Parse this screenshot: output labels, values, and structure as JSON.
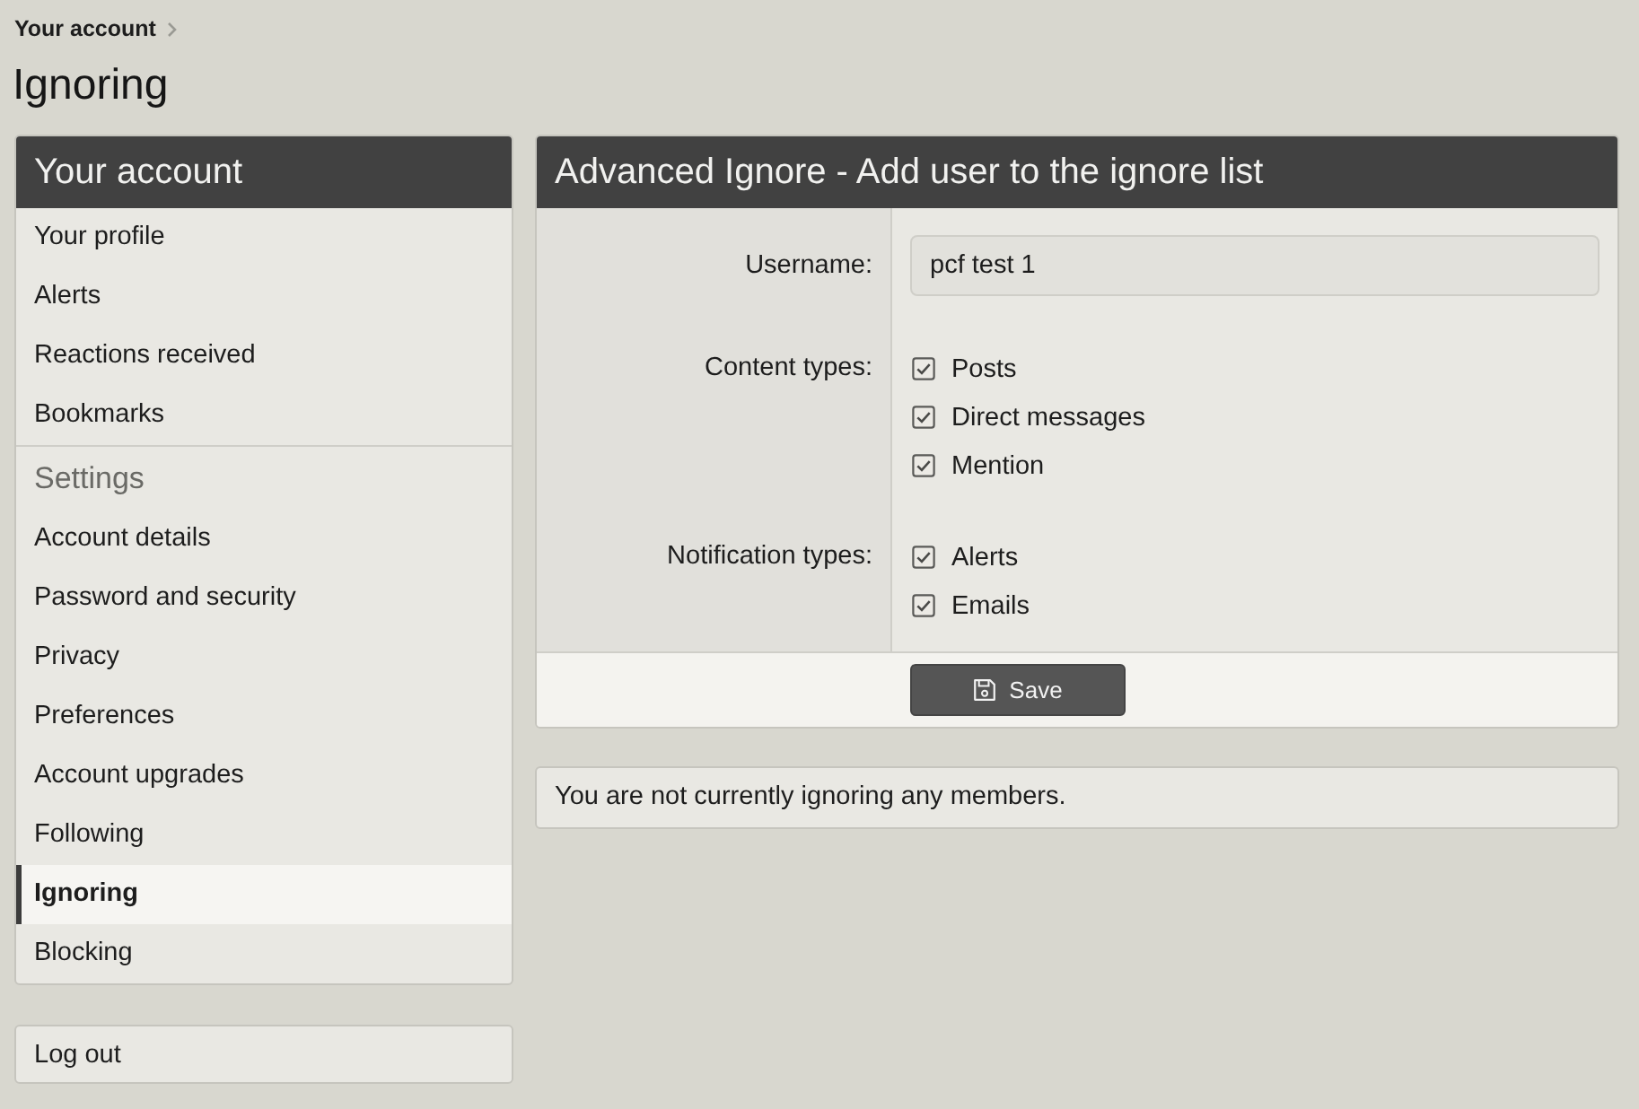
{
  "breadcrumb": [
    {
      "label": "Your account"
    }
  ],
  "page_title": "Ignoring",
  "sidebar": {
    "title": "Your account",
    "groups": [
      {
        "items": [
          {
            "label": "Your profile",
            "selected": false
          },
          {
            "label": "Alerts",
            "selected": false
          },
          {
            "label": "Reactions received",
            "selected": false
          },
          {
            "label": "Bookmarks",
            "selected": false
          }
        ]
      },
      {
        "heading": "Settings",
        "items": [
          {
            "label": "Account details",
            "selected": false
          },
          {
            "label": "Password and security",
            "selected": false
          },
          {
            "label": "Privacy",
            "selected": false
          },
          {
            "label": "Preferences",
            "selected": false
          },
          {
            "label": "Account upgrades",
            "selected": false
          },
          {
            "label": "Following",
            "selected": false
          },
          {
            "label": "Ignoring",
            "selected": true
          },
          {
            "label": "Blocking",
            "selected": false
          }
        ]
      }
    ]
  },
  "logout": {
    "label": "Log out"
  },
  "form": {
    "title": "Advanced Ignore - Add user to the ignore list",
    "fields": [
      {
        "kind": "text",
        "label": "Username:",
        "value": "pcf test 1"
      },
      {
        "kind": "checkboxes",
        "label": "Content types:",
        "options": [
          {
            "label": "Posts",
            "checked": true
          },
          {
            "label": "Direct messages",
            "checked": true
          },
          {
            "label": "Mention",
            "checked": true
          }
        ]
      },
      {
        "kind": "checkboxes",
        "label": "Notification types:",
        "options": [
          {
            "label": "Alerts",
            "checked": true
          },
          {
            "label": "Emails",
            "checked": true
          }
        ]
      }
    ],
    "submit": {
      "label": "Save"
    }
  },
  "notice": "You are not currently ignoring any members."
}
